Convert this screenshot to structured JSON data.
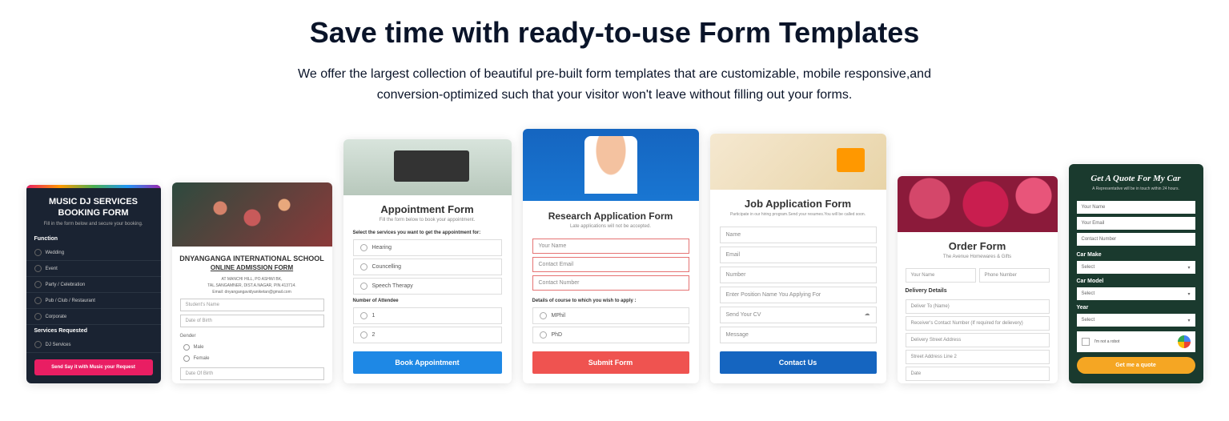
{
  "hero": {
    "title": "Save time with ready-to-use Form Templates",
    "description": "We offer the largest collection of beautiful pre-built form templates that are customizable, mobile responsive,and conversion-optimized such that your visitor won't leave without filling out your forms."
  },
  "cards": {
    "c1": {
      "title": "MUSIC DJ SERVICES BOOKING FORM",
      "subtitle": "Fill in the form below and secure your booking.",
      "sec1": "Function",
      "opts1": [
        "Wedding",
        "Event",
        "Party / Celebration",
        "Pub / Club / Restaurant",
        "Corporate"
      ],
      "sec2": "Services Requested",
      "opts2": [
        "DJ Services"
      ],
      "button": "Send Say it with Music your Request"
    },
    "c2": {
      "title": "DNYANGANGA INTERNATIONAL SCHOOL",
      "link": "ONLINE ADMISSION FORM",
      "meta1": "AT MANCHI HILL, PO ASHWI BK,",
      "meta2": "TAL.SANGAMNER, DIST.A.NAGAR, PIN.413714.",
      "meta3": "Email: dnyangangavidyaniketan@gmail.com",
      "inp1": "Student's Name",
      "inp2": "Date of Birth",
      "lbl_gender": "Gender",
      "gopt1": "Male",
      "gopt2": "Female",
      "inp3": "Date Of Birth"
    },
    "c3": {
      "title": "Appointment Form",
      "subtitle": "Fill the form below to book your appointment.",
      "lbl1": "Select the services you want to get the appointment for:",
      "opts": [
        "Hearing",
        "Councelling",
        "Speech Therapy"
      ],
      "lbl2": "Number of Attendee",
      "nums": [
        "1",
        "2"
      ],
      "button": "Book Appointment"
    },
    "c4": {
      "title": "Research Application Form",
      "subtitle": "Late applications will not be accepted.",
      "inp1": "Your Name",
      "inp2": "Contact Email",
      "inp3": "Contact Number",
      "lbl": "Details of course to which you wish to apply :",
      "opts": [
        "MPhil",
        "PhD"
      ],
      "button": "Submit Form"
    },
    "c5": {
      "title": "Job Application Form",
      "subtitle": "Participate in our hiring program.Send your resumes.You will be called soon.",
      "inp1": "Name",
      "inp2": "Email",
      "inp3": "Number",
      "inp4": "Enter Position Name You Applying For",
      "inp5": "Send Your CV",
      "inp6": "Message",
      "button": "Contact Us"
    },
    "c6": {
      "title": "Order Form",
      "subtitle": "The Avenue Homewares & Gifts",
      "inp1": "Your Name",
      "inp2": "Phone Number",
      "lbl": "Delivery Details",
      "inp3": "Deliver To (Name)",
      "inp4": "Receiver's Contact Number (If required for delievery)",
      "inp5": "Delivery Street Address",
      "inp6": "Street Address Line 2",
      "inp7": "Date"
    },
    "c7": {
      "title": "Get A Quote For My Car",
      "subtitle": "A Representative will be in touch within 24 hours.",
      "inp1": "Your Name",
      "inp2": "Your Email",
      "inp3": "Contact Number",
      "lbl1": "Car Make",
      "sel1": "Select",
      "lbl2": "Car Model",
      "sel2": "Select",
      "lbl3": "Year",
      "sel3": "Select",
      "cap": "I'm not a robot",
      "button": "Get me a quote"
    }
  }
}
